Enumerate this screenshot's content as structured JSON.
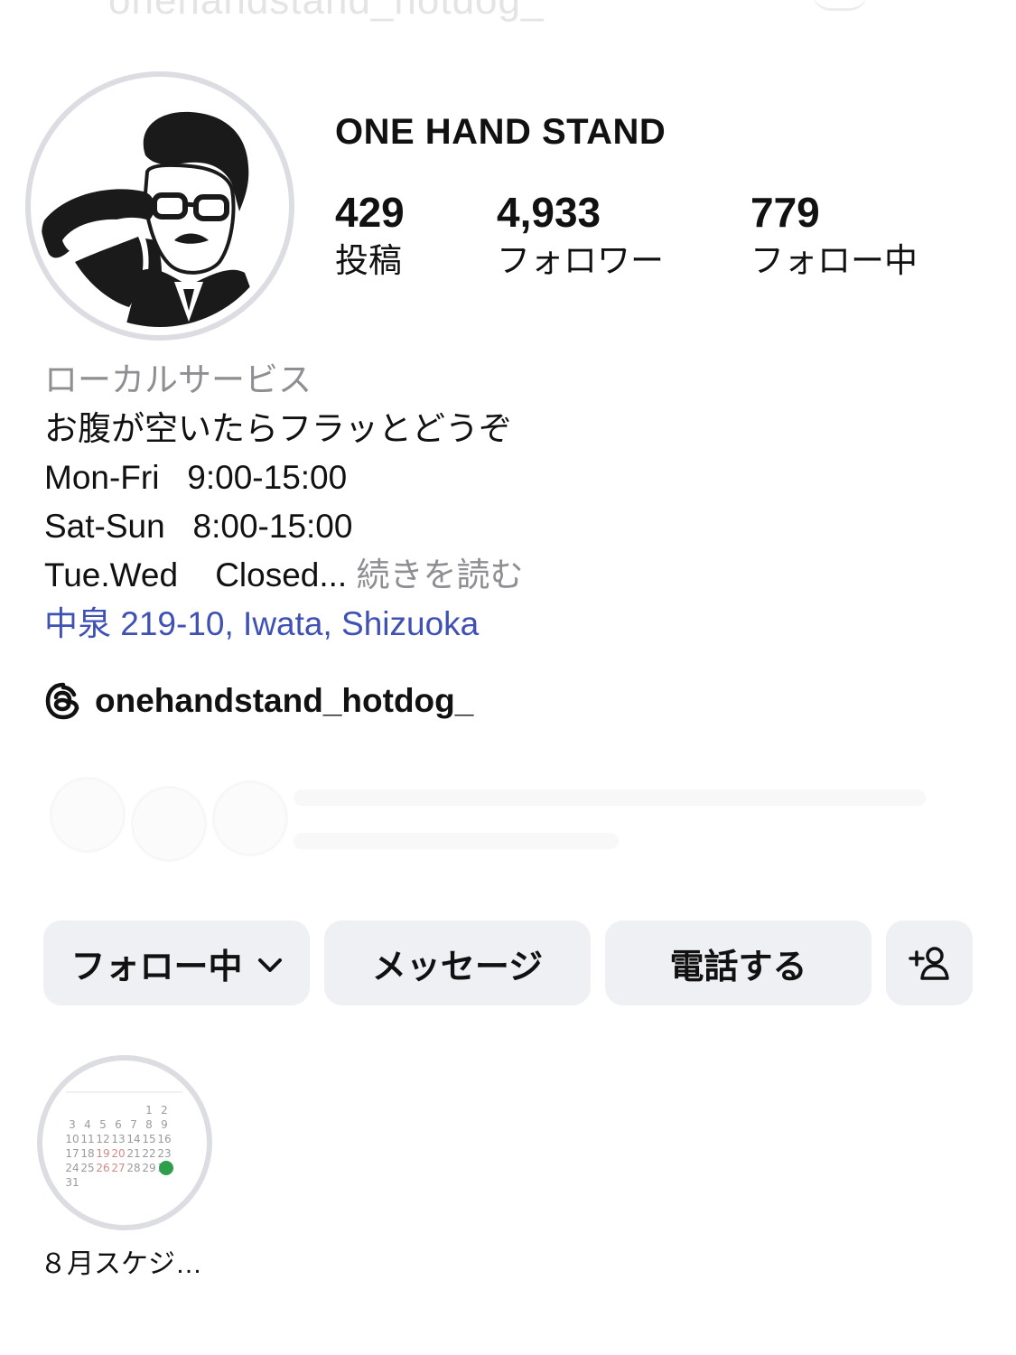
{
  "header": {
    "username_ghost": "onehandstand_hotdog_"
  },
  "profile": {
    "name": "ONE HAND STAND"
  },
  "stats": [
    {
      "value": "429",
      "label": "投稿"
    },
    {
      "value": "4,933",
      "label": "フォロワー"
    },
    {
      "value": "779",
      "label": "フォロー中"
    }
  ],
  "bio": {
    "category": "ローカルサービス",
    "lines": [
      "お腹が空いたらフラッとどうぞ",
      "Mon-Fri   9:00-15:00",
      "Sat-Sun   8:00-15:00"
    ],
    "last_line": "Tue.Wed    Closed...",
    "more": "続きを読む",
    "address": "中泉 219-10, Iwata, Shizuoka"
  },
  "threads": {
    "icon": "threads-icon",
    "handle": "onehandstand_hotdog_"
  },
  "buttons": {
    "following": "フォロー中",
    "message": "メッセージ",
    "call": "電話する",
    "add_person_icon": "add-person-icon"
  },
  "highlight": {
    "label": "８月スケジ…",
    "calendar_days": [
      "1",
      "2",
      "3",
      "4",
      "5",
      "6",
      "7",
      "8",
      "9",
      "10",
      "11",
      "12",
      "13",
      "14",
      "15",
      "16",
      "17",
      "18",
      "19",
      "20",
      "21",
      "22",
      "23",
      "24",
      "25",
      "26",
      "27",
      "28",
      "29",
      "30",
      "31"
    ]
  },
  "colors": {
    "link": "#3f51b5",
    "secondary_text": "#8e8e93",
    "button_bg": "#eff0f4",
    "ring": "#dcdde2"
  }
}
